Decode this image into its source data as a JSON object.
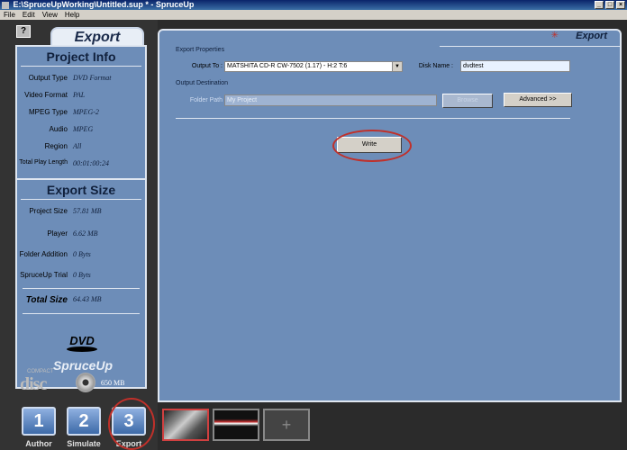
{
  "window": {
    "title": "E:\\SpruceUpWorking\\Untitled.sup * - SpruceUp",
    "btn_min": "_",
    "btn_max": "□",
    "btn_close": "×"
  },
  "menu": [
    "File",
    "Edit",
    "View",
    "Help"
  ],
  "left": {
    "help_label": "?",
    "tab_label": "Export",
    "project_info": {
      "title": "Project Info",
      "rows": [
        {
          "label": "Output Type",
          "value": "DVD Format"
        },
        {
          "label": "Video Format",
          "value": "PAL"
        },
        {
          "label": "MPEG Type",
          "value": "MPEG-2"
        },
        {
          "label": "Audio",
          "value": "MPEG"
        },
        {
          "label": "Region",
          "value": "All"
        },
        {
          "label": "Total Play Length",
          "value": "00:01:00:24"
        }
      ]
    },
    "export_size": {
      "title": "Export Size",
      "rows": [
        {
          "label": "Project Size",
          "value": "57.81 MB"
        },
        {
          "label": "Player",
          "value": "6.62 MB"
        },
        {
          "label": "Folder Addition",
          "value": "0 Byts"
        },
        {
          "label": "SpruceUp Trial",
          "value": "0 Byts"
        }
      ],
      "total_label": "Total Size",
      "total_value": "64.43 MB"
    },
    "dvd_logo": "DVD",
    "spruce_logo": "SpruceUp",
    "cd_logo": "disc",
    "cd_logo_top": "COMPACT",
    "cd_size": "650 MB",
    "modes": [
      {
        "num": "1",
        "label": "Author"
      },
      {
        "num": "2",
        "label": "Simulate"
      },
      {
        "num": "3",
        "label": "Export"
      }
    ]
  },
  "main": {
    "tab_label": "Export",
    "export_properties_title": "Export Properties",
    "output_to_label": "Output To :",
    "output_to_value": "MATSHITA CD-R   CW-7502 (1.17) - H:2 T:6",
    "disk_name_label": "Disk Name :",
    "disk_name_value": "dvdtest",
    "output_destination_title": "Output Destination",
    "folder_path_label": "Folder Path",
    "folder_path_value": "My Project",
    "browse_label": "Browse",
    "advanced_label": "Advanced >>",
    "write_label": "Write"
  },
  "colors": {
    "panel": "#6d8db8",
    "annotation": "#c0302a"
  }
}
